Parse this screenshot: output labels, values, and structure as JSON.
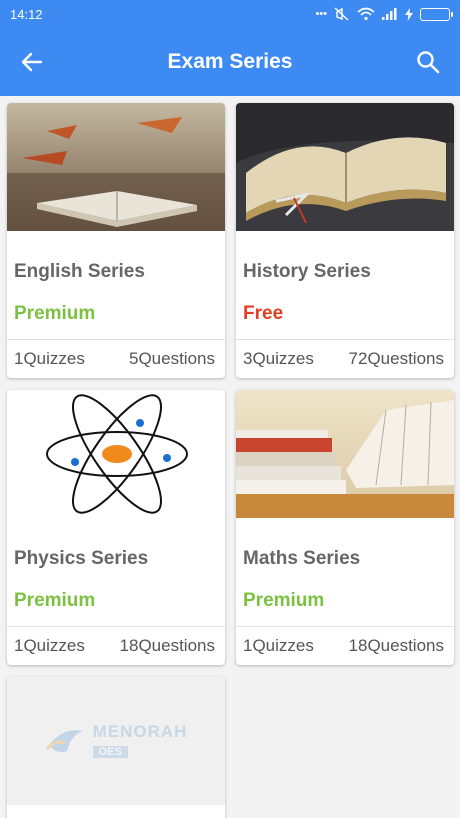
{
  "status_bar": {
    "time": "14:12"
  },
  "app_bar": {
    "title": "Exam Series"
  },
  "colors": {
    "primary": "#3d8bf2",
    "premium": "#7cc142",
    "free": "#e53d1f"
  },
  "cards": [
    {
      "name": "English Series",
      "tier": "Premium",
      "quizzes": "1Quizzes",
      "questions": "5Questions"
    },
    {
      "name": "History Series",
      "tier": "Free",
      "quizzes": "3Quizzes",
      "questions": "72Questions"
    },
    {
      "name": "Physics Series",
      "tier": "Premium",
      "quizzes": "1Quizzes",
      "questions": "18Questions"
    },
    {
      "name": "Maths Series",
      "tier": "Premium",
      "quizzes": "1Quizzes",
      "questions": "18Questions"
    }
  ],
  "placeholder_logo": {
    "brand": "MENORAH",
    "sub": "OES"
  }
}
